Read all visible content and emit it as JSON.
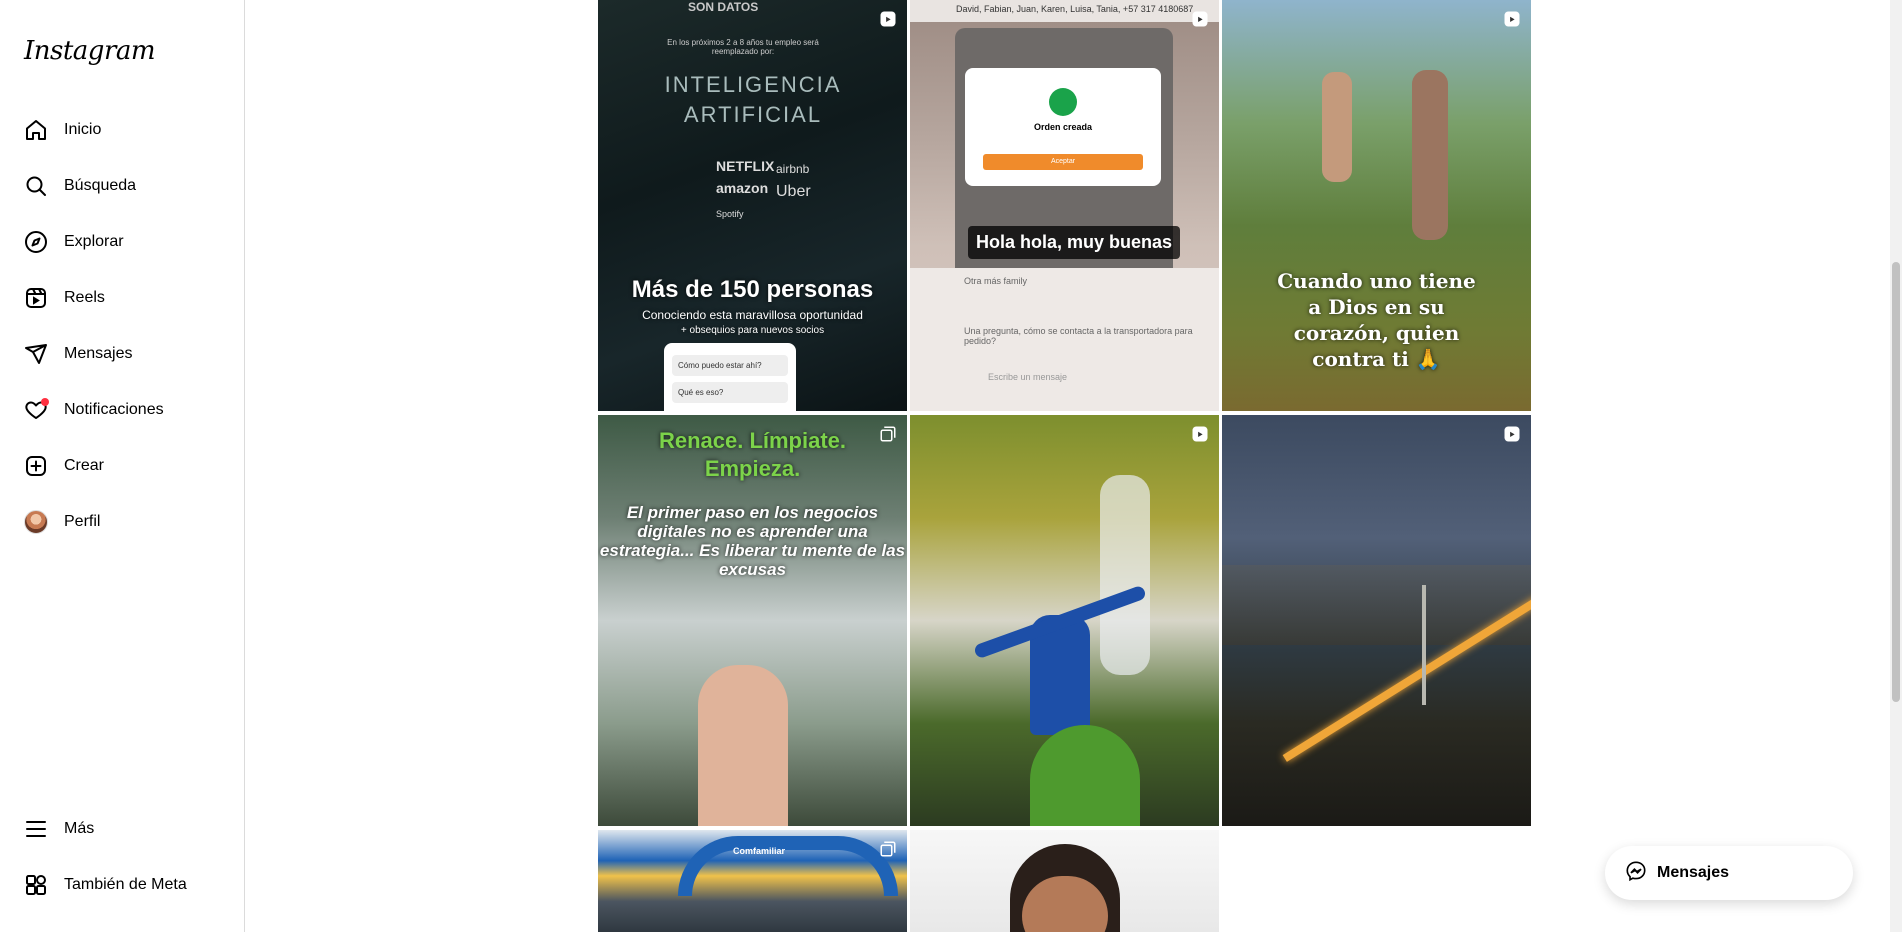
{
  "sidebar": {
    "logo": "Instagram",
    "items": [
      {
        "label": "Inicio"
      },
      {
        "label": "Búsqueda"
      },
      {
        "label": "Explorar"
      },
      {
        "label": "Reels"
      },
      {
        "label": "Mensajes"
      },
      {
        "label": "Notificaciones"
      },
      {
        "label": "Crear"
      },
      {
        "label": "Perfil"
      }
    ],
    "bottom": [
      {
        "label": "Más"
      },
      {
        "label": "También de Meta"
      }
    ]
  },
  "posts": [
    {
      "type": "reel",
      "texts": [
        "SON DATOS",
        "En los próximos 2 a 8 años tu empleo será reemplazado por:",
        "INTELIGENCIA ARTIFICIAL",
        "NETFLIX",
        "airbnb",
        "amazon",
        "Uber",
        "Spotify",
        "Más de 150 personas",
        "Conociendo esta maravillosa oportunidad",
        "+ obsequios para nuevos socios",
        "Cómo puedo estar ahí?",
        "Qué es eso?"
      ]
    },
    {
      "type": "reel",
      "texts": [
        "David, Fabian, Juan, Karen, Luisa, Tania, +57 317 4180687",
        "Orden creada",
        "Aceptar",
        "Hola hola, muy buenas",
        "Otra más family",
        "Una pregunta, cómo se contacta a la transportadora para pedido?",
        "Escribe un mensaje"
      ]
    },
    {
      "type": "reel",
      "texts": [
        "Cuando uno tiene a Dios en su corazón, quien contra ti 🙏"
      ]
    },
    {
      "type": "carousel",
      "texts": [
        "Renace. Límpiate. Empieza.",
        "El primer paso en los negocios digitales no es aprender una estrategia... Es liberar tu mente de las excusas"
      ]
    },
    {
      "type": "reel",
      "texts": []
    },
    {
      "type": "reel",
      "texts": []
    },
    {
      "type": "carousel",
      "texts": [
        "Comfamiliar"
      ]
    },
    {
      "type": "photo",
      "texts": []
    }
  ],
  "floating": {
    "messages_label": "Mensajes"
  },
  "colors": {
    "accent_dot": "#ff3040",
    "border": "#dbdbdb",
    "title_green": "#7cd34a"
  }
}
